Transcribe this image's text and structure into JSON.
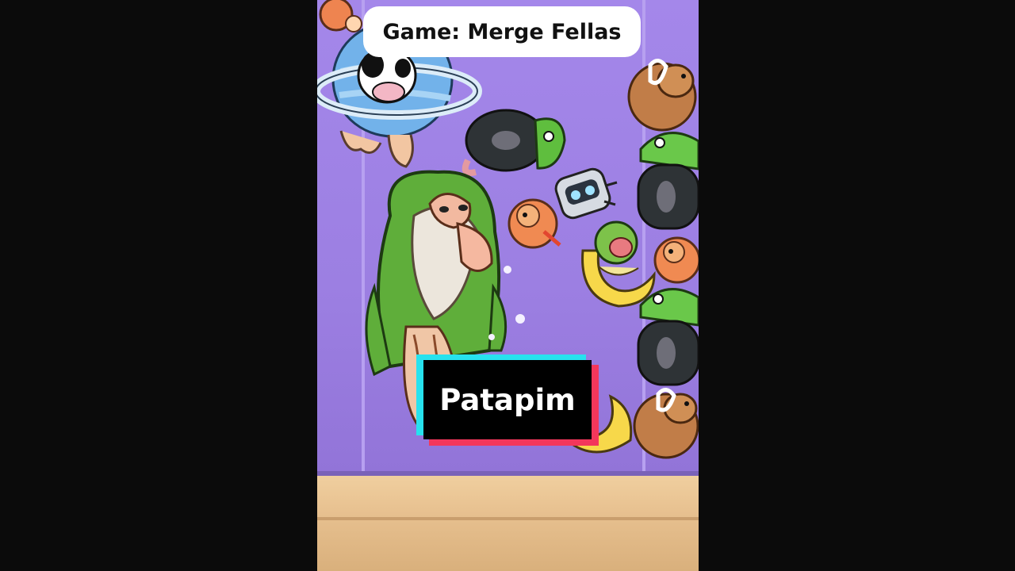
{
  "overlay": {
    "game_title": "Game: Merge Fellas",
    "caption": "Patapim"
  },
  "colors": {
    "tank_wall": "#a083e6",
    "floor": "#e7c08f",
    "caption_accent_cyan": "#27e2ee",
    "caption_accent_red": "#f3375b"
  },
  "characters": [
    "planet-cow-character",
    "tire-frog-character",
    "capybara-character",
    "shrimp-cat-character",
    "robot-bug-character",
    "banana-monkey-character",
    "tree-man-character"
  ]
}
